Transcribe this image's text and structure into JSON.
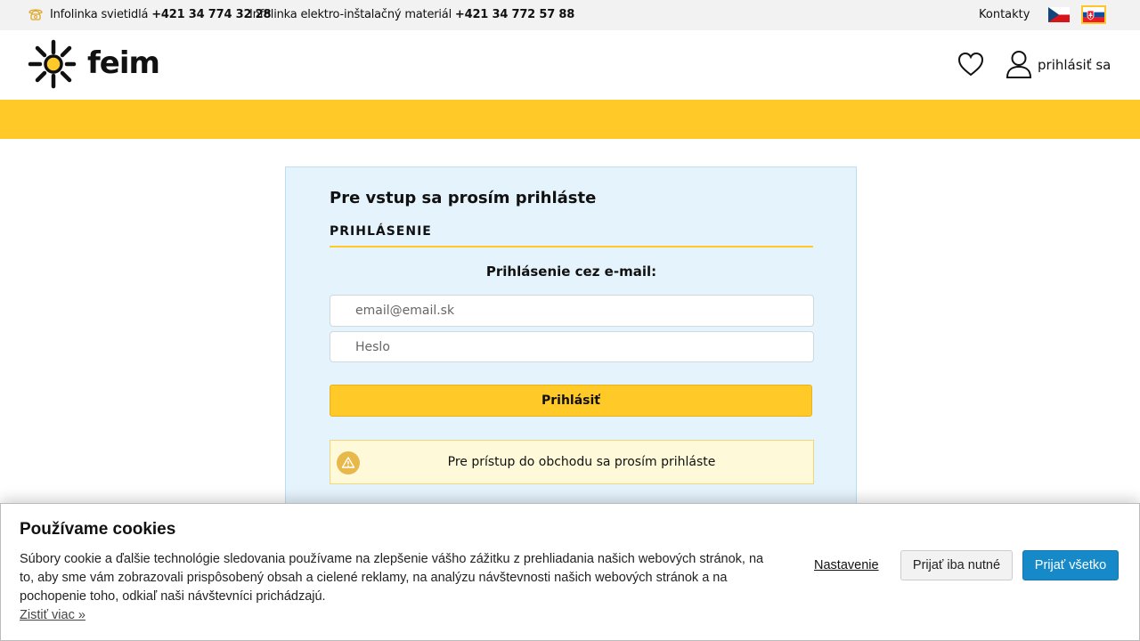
{
  "topbar": {
    "infoline_lights_label": "Infolinka svietidlá",
    "infoline_lights_phone": "+421 34 774 32 28",
    "infoline_electro_label": "Infolinka elektro-inštalačný materiál",
    "infoline_electro_phone": "+421 34 772 57 88",
    "contacts_link": "Kontakty",
    "languages": [
      "cz",
      "sk"
    ],
    "active_language": "sk",
    "icon": "phone-icon"
  },
  "header": {
    "logo_text": "feim",
    "login_label": "prihlásiť sa",
    "icons": [
      "heart-icon",
      "user-icon"
    ]
  },
  "colors": {
    "brand_yellow": "#ffc927",
    "panel_bg": "#e5f3fc",
    "accept_all_blue": "#1689c9"
  },
  "login": {
    "title": "Pre vstup sa prosím prihláste",
    "section_title": "PRIHLÁSENIE",
    "email_caption": "Prihlásenie cez e-mail:",
    "email_placeholder": "email@email.sk",
    "password_placeholder": "Heslo",
    "submit_label": "Prihlásiť",
    "notice_text": "Pre prístup do obchodu sa prosím prihláste",
    "notice_icon": "warning-icon"
  },
  "cookies": {
    "title": "Používame cookies",
    "text": "Súbory cookie a ďalšie technológie sledovania používame na zlepšenie vášho zážitku z prehliadania našich webových stránok, na to, aby sme vám zobrazovali prispôsobený obsah a cielené reklamy, na analýzu návštevnosti našich webových stránok a na pochopenie toho, odkiaľ naši návštevníci prichádzajú.",
    "more_link": "Zistiť viac »",
    "settings_link": "Nastavenie",
    "accept_necessary": "Prijať iba nutné",
    "accept_all": "Prijať všetko"
  }
}
